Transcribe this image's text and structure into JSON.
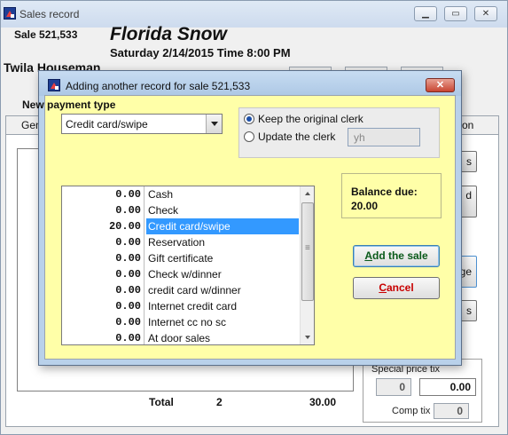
{
  "window": {
    "title": "Sales record",
    "min_label": "▁",
    "max_label": "▭",
    "close_label": "✕"
  },
  "header": {
    "sale_label": "Sale 521,533",
    "event_title": "Florida Snow",
    "event_date": "Saturday 2/14/2015  Time 8:00 PM",
    "customer_name": "Twila Houseman"
  },
  "background": {
    "tabs": [
      "Gen",
      "on"
    ],
    "side_buttons": [
      "s",
      "d",
      "ge",
      "s"
    ],
    "special_price_label": "Special price tix",
    "special_price_count": "0",
    "special_price_amount": "0.00",
    "comp_label": "Comp tix",
    "comp_value": "0",
    "total_label": "Total",
    "total_count": "2",
    "total_amount": "30.00"
  },
  "dialog": {
    "title": "Adding another record for sale 521,533",
    "close_label": "✕",
    "payment_type_label": "New payment type",
    "payment_type_value": "Credit card/swipe",
    "clerk_options": [
      {
        "label": "Keep the original clerk",
        "checked": true
      },
      {
        "label": "Update the clerk",
        "checked": false
      }
    ],
    "clerk_input_value": "yh",
    "balance_label": "Balance due:",
    "balance_value": "20.00",
    "add_button_label": "Add the sale",
    "cancel_button_label": "Cancel",
    "selected_payment_index": 2,
    "payments": [
      {
        "amount": "0.00",
        "name": "Cash"
      },
      {
        "amount": "0.00",
        "name": "Check"
      },
      {
        "amount": "20.00",
        "name": "Credit card/swipe"
      },
      {
        "amount": "0.00",
        "name": "Reservation"
      },
      {
        "amount": "0.00",
        "name": "Gift certificate"
      },
      {
        "amount": "0.00",
        "name": "Check w/dinner"
      },
      {
        "amount": "0.00",
        "name": "credit card w/dinner"
      },
      {
        "amount": "0.00",
        "name": "Internet credit card"
      },
      {
        "amount": "0.00",
        "name": "Internet cc no sc"
      },
      {
        "amount": "0.00",
        "name": "At door sales"
      }
    ]
  },
  "colors": {
    "dialog_background": "#ffffa8",
    "selection": "#3399ff",
    "add_button_text": "#0a5a1a",
    "cancel_button_text": "#c80000",
    "close_button": "#c84531"
  },
  "icons": {
    "app": "app-icon",
    "dialog": "app-icon",
    "dropdown": "chevron-down-icon",
    "scroll_up": "arrow-up-icon",
    "scroll_down": "arrow-down-icon"
  }
}
